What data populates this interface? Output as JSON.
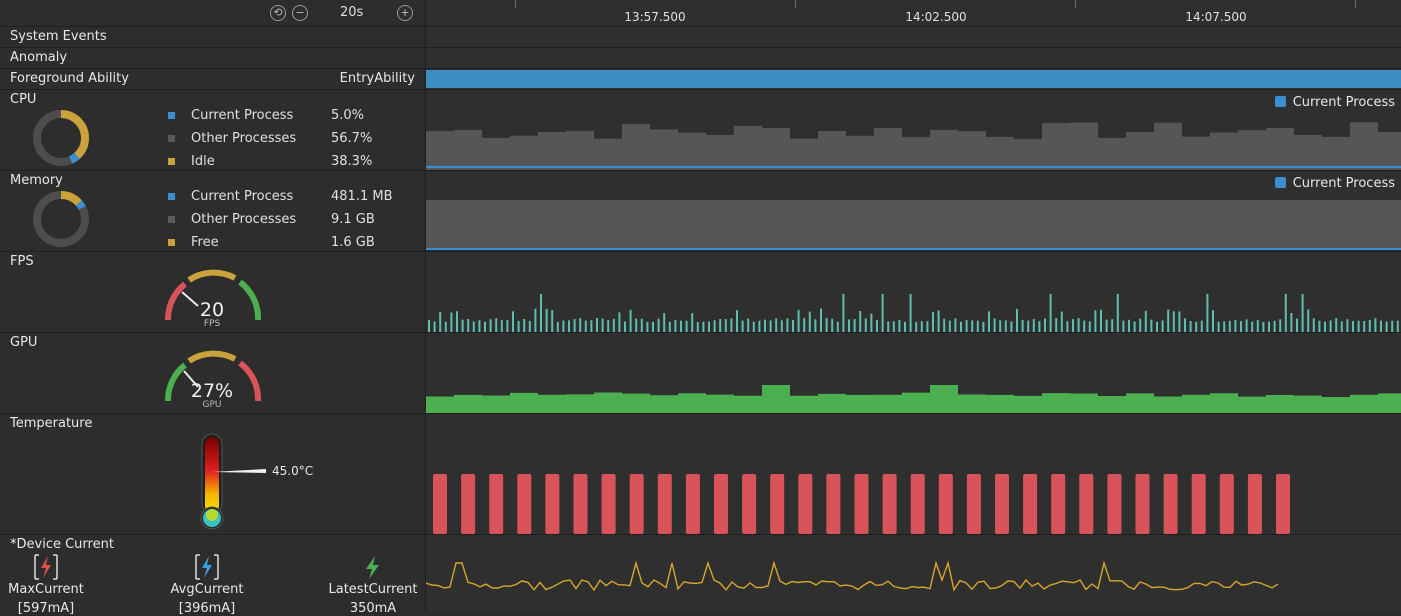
{
  "toolbar": {
    "zoom_label": "20s",
    "reset_icon": "reset-icon",
    "zoom_out_icon": "zoom-out-icon",
    "zoom_in_icon": "zoom-in-icon"
  },
  "timeline": {
    "ticks": [
      "13:57.500",
      "14:02.500",
      "14:07.500"
    ]
  },
  "rows": {
    "system_events": "System Events",
    "anomaly": "Anomaly",
    "foreground_ability": {
      "label": "Foreground Ability",
      "value": "EntryAbility"
    },
    "cpu": {
      "label": "CPU",
      "legend": [
        {
          "name": "Current Process",
          "value": "5.0%",
          "color": "#3b8fd1"
        },
        {
          "name": "Other Processes",
          "value": "56.7%",
          "color": "#5a5a5a"
        },
        {
          "name": "Idle",
          "value": "38.3%",
          "color": "#c9a23b"
        }
      ],
      "chip": "Current Process"
    },
    "memory": {
      "label": "Memory",
      "legend": [
        {
          "name": "Current Process",
          "value": "481.1 MB",
          "color": "#3b8fd1"
        },
        {
          "name": "Other Processes",
          "value": "9.1 GB",
          "color": "#5a5a5a"
        },
        {
          "name": "Free",
          "value": "1.6 GB",
          "color": "#c9a23b"
        }
      ],
      "chip": "Current Process"
    },
    "fps": {
      "label": "FPS",
      "value": "20",
      "unit": "FPS"
    },
    "gpu": {
      "label": "GPU",
      "value": "27%",
      "unit": "GPU"
    },
    "temperature": {
      "label": "Temperature",
      "value": "45.0°C"
    },
    "device_current": {
      "label": "*Device Current",
      "stats": [
        {
          "name": "MaxCurrent",
          "value": "[597mA]",
          "icon": "max-current-icon",
          "color": "#e0504d"
        },
        {
          "name": "AvgCurrent",
          "value": "[396mA]",
          "icon": "avg-current-icon",
          "color": "#3aa0e0"
        },
        {
          "name": "LatestCurrent",
          "value": "350mA",
          "icon": "latest-current-icon",
          "color": "#4caf50"
        }
      ]
    }
  },
  "colors": {
    "accent_blue": "#3b8fd1",
    "fps_teal": "#5fbfae",
    "gpu_green": "#4caf50",
    "temp_red": "#d9545a",
    "current_yellow": "#d6a52c"
  }
}
